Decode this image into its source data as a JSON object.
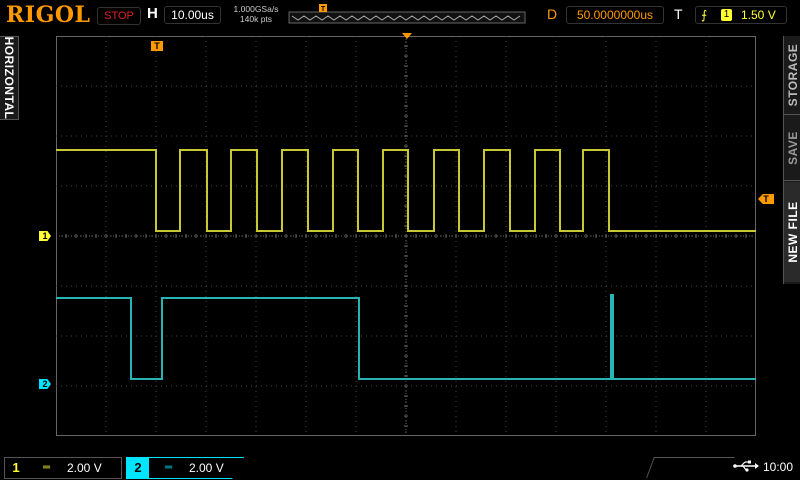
{
  "brand": "RIGOL",
  "top_bar": {
    "run_status": "STOP",
    "horizontal_label": "H",
    "timebase": "10.00us",
    "sample_rate": "1.000GSa/s",
    "memory_depth": "140k pts",
    "delay_label": "D",
    "delay": "50.0000000us",
    "trigger_label": "T",
    "trigger_source": "1",
    "trigger_level": "1.50 V"
  },
  "left_tab": {
    "label": "HORIZONTAL"
  },
  "right_menu": {
    "items": [
      {
        "label": "STORAGE"
      },
      {
        "label": "SAVE"
      },
      {
        "label": "NEW FILE"
      }
    ]
  },
  "markers": {
    "trigger_pos": "T",
    "trigger_level": "T",
    "ch1_ground": "1",
    "ch2_ground": "2"
  },
  "channels": [
    {
      "number": "1",
      "coupling": "DC",
      "scale": "2.00 V",
      "color": "#ffff33"
    },
    {
      "number": "2",
      "coupling": "DC",
      "scale": "2.00 V",
      "color": "#00e5ff"
    }
  ],
  "status": {
    "usb": "usb-icon",
    "time": "10:00"
  },
  "colors": {
    "ch1": "#c8c832",
    "ch2": "#28b4b4",
    "accent": "#ff9900",
    "grid": "#555555"
  }
}
